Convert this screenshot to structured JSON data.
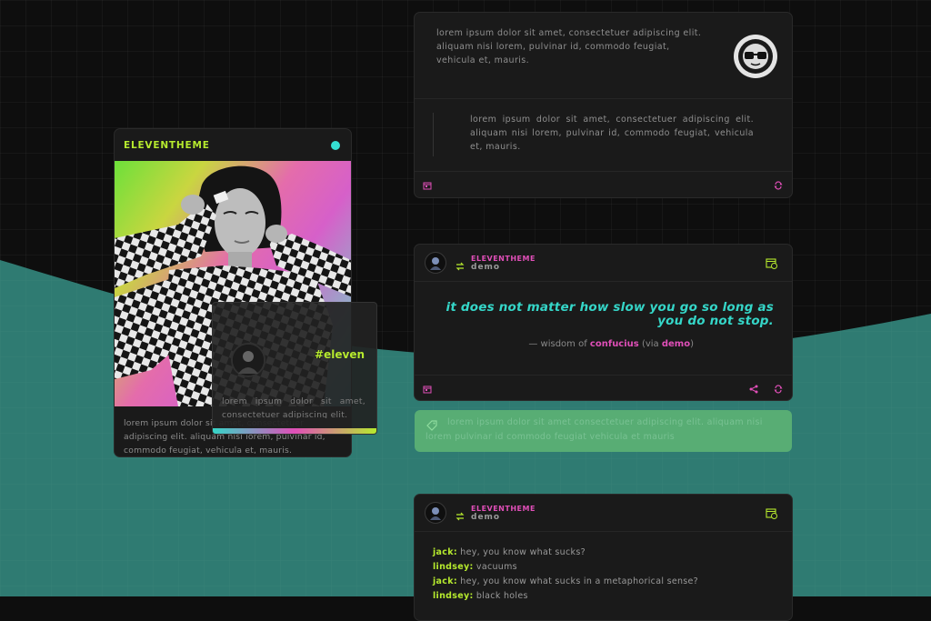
{
  "colors": {
    "background": "#0e0e0e",
    "wave": "#2f7b72",
    "card": "#1a1a1a",
    "lime": "#b6ea2e",
    "pink": "#e04fb8",
    "teal": "#35d6c8",
    "tags_box": "#58ad74"
  },
  "profile": {
    "brand": "ELEVENTHEME",
    "bio": "lorem ipsum dolor sit amet, consectetuer adipiscing elit. aliquam nisi lorem, pulvinar id, commodo feugiat, vehicula et, mauris.",
    "status_dot": "online-dot-icon"
  },
  "mini_card": {
    "tag": "#eleven",
    "text": "lorem ipsum dolor sit amet, consectetuer adipiscing elit."
  },
  "post1": {
    "text": "lorem ipsum dolor sit amet, consectetuer adipiscing elit. aliquam nisi lorem, pulvinar id, commodo feugiat, vehicula et, mauris.",
    "quote": "lorem ipsum dolor sit amet, consectetuer adipiscing elit. aliquam nisi lorem, pulvinar id, commodo feugiat, vehicula et, mauris."
  },
  "post2": {
    "reblogger": "ELEVENTHEME",
    "source": "demo",
    "quote": "it does not matter how slow you go so long as you do not stop.",
    "attr_prefix": "— wisdom of",
    "attr_author": "confucius",
    "attr_via_open": "(via",
    "attr_via": "demo",
    "attr_close": ")"
  },
  "tags": {
    "text": "lorem ipsum dolor sit amet consectetuer adipiscing elit. aliquam nisi lorem pulvinar id commodo feugiat vehicula et mauris"
  },
  "post3": {
    "reblogger": "ELEVENTHEME",
    "source": "demo",
    "chat": [
      {
        "speaker": "jack:",
        "line": "hey, you know what sucks?"
      },
      {
        "speaker": "lindsey:",
        "line": "vacuums"
      },
      {
        "speaker": "jack:",
        "line": "hey, you know what sucks in a metaphorical sense?"
      },
      {
        "speaker": "lindsey:",
        "line": "black holes"
      }
    ]
  }
}
